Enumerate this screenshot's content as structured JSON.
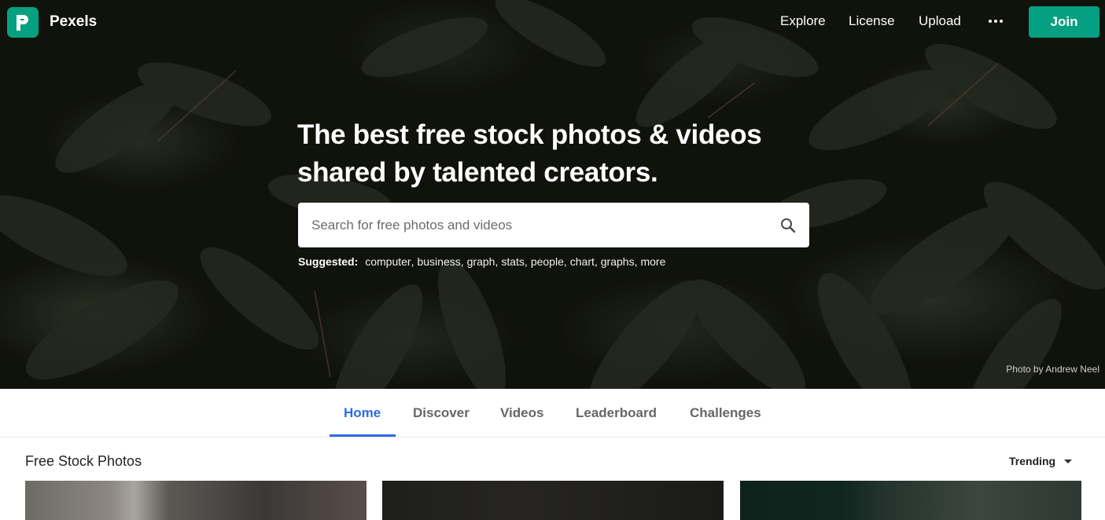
{
  "brand": {
    "name": "Pexels",
    "accent_color": "#05a081"
  },
  "nav": {
    "links": [
      "Explore",
      "License",
      "Upload"
    ],
    "more_icon": "ellipsis-icon",
    "join_label": "Join"
  },
  "hero": {
    "headline_line1": "The best free stock photos & videos",
    "headline_line2": "shared by talented creators.",
    "search_placeholder": "Search for free photos and videos",
    "search_icon": "search-icon",
    "suggested_label": "Suggested:",
    "suggestions": [
      "computer",
      "business",
      "graph",
      "stats",
      "people",
      "chart",
      "graphs",
      "more"
    ],
    "photo_credit": "Photo by Andrew Neel"
  },
  "tabs": {
    "items": [
      "Home",
      "Discover",
      "Videos",
      "Leaderboard",
      "Challenges"
    ],
    "active": "Home",
    "active_color": "#2d6ae3"
  },
  "section": {
    "title": "Free Stock Photos",
    "sort_label": "Trending"
  }
}
